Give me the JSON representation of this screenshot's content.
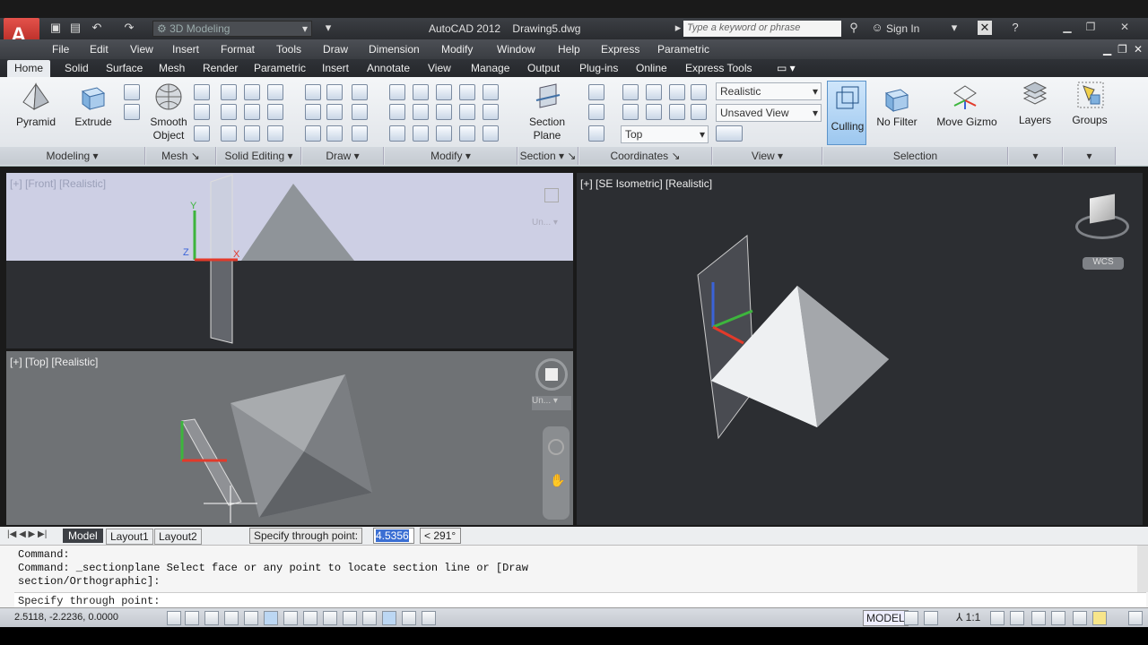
{
  "title": {
    "workspace": "3D Modeling",
    "app": "AutoCAD 2012",
    "document": "Drawing5.dwg",
    "search_placeholder": "Type a keyword or phrase",
    "sign_in": "Sign In"
  },
  "menu": [
    "File",
    "Edit",
    "View",
    "Insert",
    "Format",
    "Tools",
    "Draw",
    "Dimension",
    "Modify",
    "Window",
    "Help",
    "Express",
    "Parametric"
  ],
  "tabs": [
    "Home",
    "Solid",
    "Surface",
    "Mesh",
    "Render",
    "Parametric",
    "Insert",
    "Annotate",
    "View",
    "Manage",
    "Output",
    "Plug-ins",
    "Online",
    "Express Tools"
  ],
  "active_tab": "Home",
  "ribbon": {
    "pyramid": "Pyramid",
    "extrude": "Extrude",
    "smooth_object_1": "Smooth",
    "smooth_object_2": "Object",
    "section_plane_1": "Section",
    "section_plane_2": "Plane",
    "visual_style": "Realistic",
    "named_view": "Unsaved View",
    "ucs_view": "Top",
    "culling": "Culling",
    "no_filter": "No Filter",
    "move_gizmo": "Move Gizmo",
    "layers": "Layers",
    "groups": "Groups",
    "panels": [
      "Modeling",
      "Mesh",
      "Solid Editing",
      "Draw",
      "Modify",
      "Section",
      "Coordinates",
      "View",
      "Selection"
    ]
  },
  "viewports": {
    "front": "[+] [Front] [Realistic]",
    "top": "[+] [Top] [Realistic]",
    "iso": "[+] [SE Isometric] [Realistic]",
    "unnamed_front": "Un...",
    "unnamed_top": "Un...",
    "wcs": "WCS"
  },
  "layout_tabs": [
    "Model",
    "Layout1",
    "Layout2"
  ],
  "tooltip": {
    "prompt": "Specify through point:",
    "value": "4.5356",
    "angle": "< 291°"
  },
  "command": {
    "line1": "Command:",
    "line2": "Command: _sectionplane Select face or any point to locate section line or [Draw",
    "line3": "section/Orthographic]:",
    "line4": "Specify through point:"
  },
  "status": {
    "coords": "2.5118,  -2.2236, 0.0000",
    "model": "MODEL",
    "scale": "1:1"
  },
  "colors": {
    "accent": "#9cc7ef",
    "x_axis": "#e23a2a",
    "y_axis": "#3db53d",
    "z_axis": "#3a63d8"
  }
}
